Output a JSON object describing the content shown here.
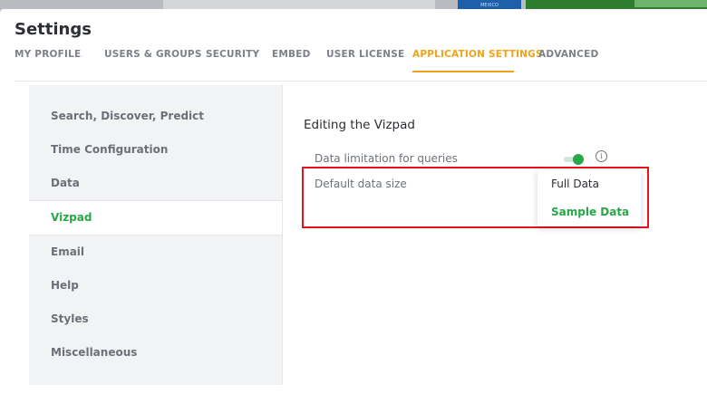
{
  "background": {
    "label": "MEXICO"
  },
  "page": {
    "title": "Settings"
  },
  "tabs": [
    {
      "label": "MY PROFILE",
      "active": false
    },
    {
      "label": "USERS & GROUPS",
      "active": false
    },
    {
      "label": "SECURITY",
      "active": false
    },
    {
      "label": "EMBED",
      "active": false
    },
    {
      "label": "USER LICENSE",
      "active": false
    },
    {
      "label": "APPLICATION SETTINGS",
      "active": true
    },
    {
      "label": "ADVANCED",
      "active": false
    }
  ],
  "sidebar": {
    "items": [
      {
        "label": "Search, Discover, Predict"
      },
      {
        "label": "Time Configuration"
      },
      {
        "label": "Data"
      },
      {
        "label": "Vizpad",
        "active": true
      },
      {
        "label": "Email"
      },
      {
        "label": "Help"
      },
      {
        "label": "Styles"
      },
      {
        "label": "Miscellaneous"
      }
    ]
  },
  "content": {
    "section_title": "Editing the Vizpad",
    "data_limitation_label": "Data limitation for queries",
    "data_limitation_enabled": true,
    "info_icon": "i",
    "default_data_size_label": "Default data size"
  },
  "dropdown": {
    "options": [
      {
        "label": "Full Data",
        "selected": false
      },
      {
        "label": "Sample Data",
        "selected": true
      }
    ]
  },
  "colors": {
    "accent_tab": "#f0a21b",
    "accent_green": "#27a748",
    "highlight_red": "#e6141b"
  }
}
